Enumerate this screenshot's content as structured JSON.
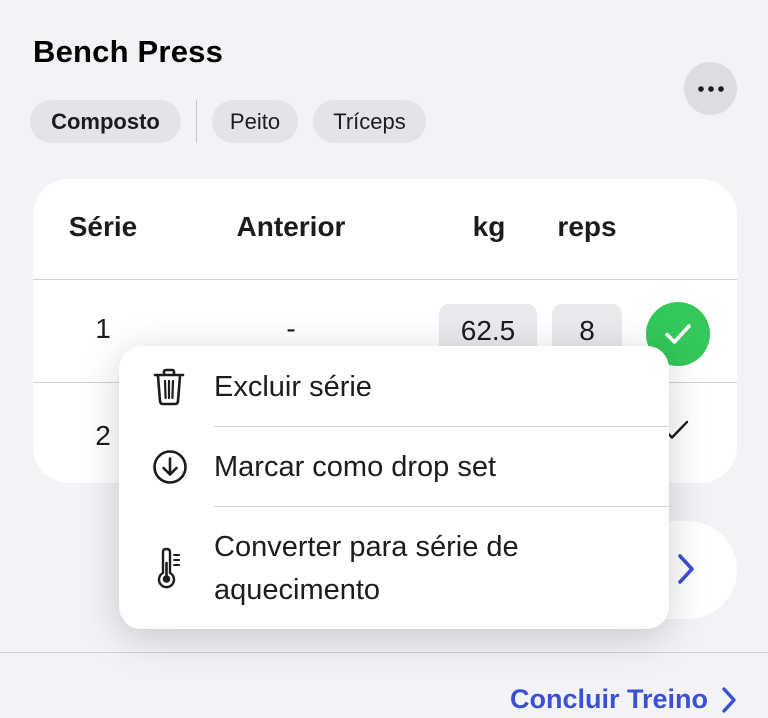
{
  "exercise": {
    "title": "Bench Press",
    "tags": [
      "Composto",
      "Peito",
      "Tríceps"
    ]
  },
  "table": {
    "headers": {
      "set": "Série",
      "previous": "Anterior",
      "weight": "kg",
      "reps": "reps"
    },
    "rows": [
      {
        "set": "1",
        "previous": "-",
        "weight": "62.5",
        "reps": "8",
        "done": true
      },
      {
        "set": "2",
        "done": false
      }
    ]
  },
  "context_menu": {
    "items": [
      {
        "label": "Excluir série",
        "icon": "trash-icon"
      },
      {
        "label": "Marcar como drop set",
        "icon": "arrow-down-circle-icon"
      },
      {
        "label_line1": "Converter para série de",
        "label_line2": "aquecimento",
        "icon": "thermometer-icon"
      }
    ]
  },
  "footer": {
    "finish_label": "Concluir Treino"
  },
  "colors": {
    "accent": "#3c50d2",
    "done": "#34c759",
    "background": "#f2f2f7"
  }
}
